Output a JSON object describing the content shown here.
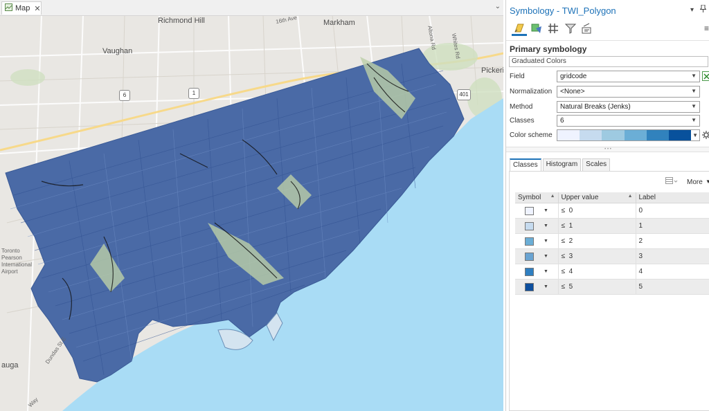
{
  "map": {
    "tab_label": "Map",
    "close_glyph": "✕",
    "dropdown_glyph": "⌄",
    "labels": {
      "richmond_hill": "Richmond Hill",
      "markham": "Markham",
      "vaughan": "Vaughan",
      "pickering": "Pickeri",
      "toronto_pearson": "Toronto\nPearson\nInternational\nAirport",
      "mississauga": "auga",
      "dundas": "Dundas St E",
      "way": "Way",
      "ave_16th": "16th Ave",
      "altona": "Altona Rd",
      "whites": "Whites Rd"
    },
    "shields": {
      "h6": "6",
      "h1": "1",
      "h401": "401"
    },
    "colors": {
      "water": "#a9dcf5",
      "land": "#e9e7e3",
      "polygon": "#4a6aa6",
      "parks": "#c8d9b8"
    }
  },
  "symbology": {
    "title": "Symbology - TWI_Polygon",
    "menu_glyph": "▾",
    "pin_glyph": "📌",
    "toolbar_menu_glyph": "≡",
    "primary_heading": "Primary symbology",
    "renderer": "Graduated Colors",
    "field_label": "Field",
    "field_value": "gridcode",
    "normalization_label": "Normalization",
    "normalization_value": "<None>",
    "method_label": "Method",
    "method_value": "Natural Breaks (Jenks)",
    "classes_label": "Classes",
    "classes_value": "6",
    "color_scheme_label": "Color scheme",
    "color_ramp": [
      "#eff3ff",
      "#c6dbef",
      "#9ecae1",
      "#6baed6",
      "#3182bd",
      "#08519c"
    ],
    "tabs": [
      "Classes",
      "Histogram",
      "Scales"
    ],
    "more_label": "More",
    "columns": {
      "symbol": "Symbol",
      "upper": "Upper value",
      "label": "Label"
    },
    "rows": [
      {
        "op": "≤",
        "upper": "0",
        "label": "0",
        "color": "#eff3ff"
      },
      {
        "op": "≤",
        "upper": "1",
        "label": "1",
        "color": "#c6dbef"
      },
      {
        "op": "≤",
        "upper": "2",
        "label": "2",
        "color": "#6baed6"
      },
      {
        "op": "≤",
        "upper": "3",
        "label": "3",
        "color": "#6aa4d2"
      },
      {
        "op": "≤",
        "upper": "4",
        "label": "4",
        "color": "#2f7fc1"
      },
      {
        "op": "≤",
        "upper": "5",
        "label": "5",
        "color": "#0d4f9e"
      }
    ]
  }
}
